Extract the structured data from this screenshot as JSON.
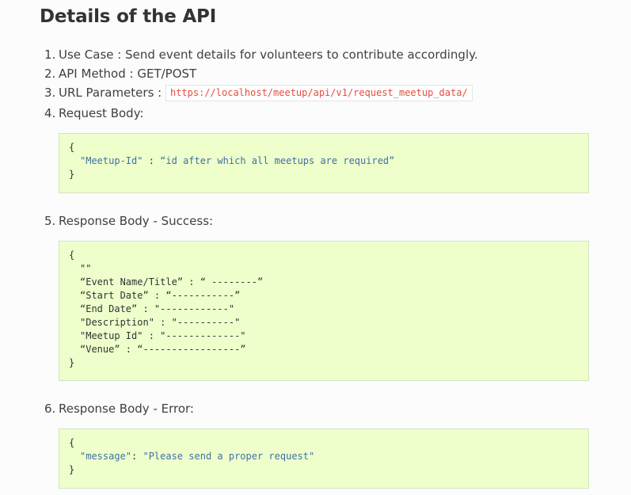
{
  "heading": "Details of the API",
  "list": {
    "item1": {
      "num": "1.",
      "text": "Use Case : Send event details for volunteers to contribute accordingly."
    },
    "item2": {
      "num": "2.",
      "text": "API Method : GET/POST"
    },
    "item3": {
      "num": "3.",
      "label": "URL Parameters :",
      "code": "https://localhost/meetup/api/v1/request_meetup_data/"
    },
    "item4": {
      "num": "4.",
      "text": "Request Body:"
    },
    "item5": {
      "num": "5.",
      "text": "Response Body - Success:"
    },
    "item6": {
      "num": "6.",
      "text": "Response Body - Error:"
    }
  },
  "request_code": {
    "open": "{",
    "key": "\"Meetup-Id\"",
    "sep": " : ",
    "value": "“id after which all meetups are required”",
    "close": "}"
  },
  "success_code": {
    "open": "{",
    "line1": "\"\"",
    "line2": "“Event Name/Title” : “ --------”",
    "line3": "“Start Date” : “-----------”",
    "line4": "“End Date” : \"------------\"",
    "line5": "\"Description\" : \"----------\"",
    "line6": "\"Meetup Id\" : \"-------------\"",
    "line7": "“Venue” : “-----------------”",
    "close": "}"
  },
  "error_code": {
    "open": "{",
    "key": "\"message\"",
    "sep": ": ",
    "value": "\"Please send a proper request\"",
    "close": "}"
  }
}
